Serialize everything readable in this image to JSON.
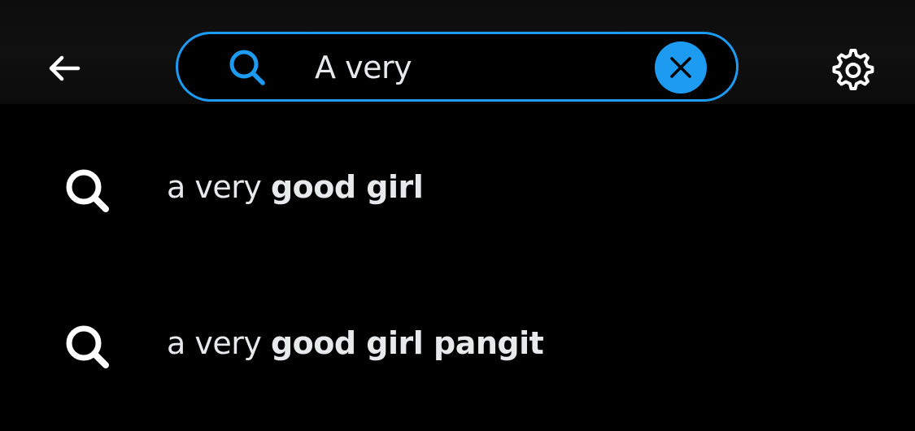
{
  "header": {
    "back_icon": "arrow-left-icon",
    "search": {
      "value": "A very",
      "icon": "search-icon",
      "clear_icon": "close-icon"
    },
    "settings_icon": "gear-icon"
  },
  "suggestions": [
    {
      "prefix": "a very ",
      "match": "good girl",
      "icon": "search-icon"
    },
    {
      "prefix": "a very ",
      "match": "good girl pangit",
      "icon": "search-icon"
    }
  ],
  "colors": {
    "accent": "#1d9bf0",
    "text": "#e7e9ea",
    "background": "#000000"
  }
}
